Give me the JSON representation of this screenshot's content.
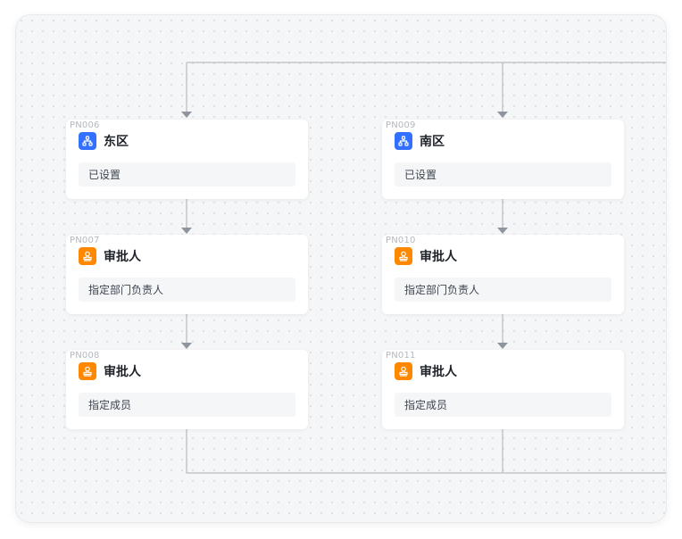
{
  "flow": {
    "columns": [
      {
        "nodes": [
          {
            "id": "PN006",
            "title": "东区",
            "icon": "branch-icon",
            "kind": "branch",
            "detail": "已设置"
          },
          {
            "id": "PN007",
            "title": "审批人",
            "icon": "stamp-icon",
            "kind": "approver",
            "detail": "指定部门负责人"
          },
          {
            "id": "PN008",
            "title": "审批人",
            "icon": "stamp-icon",
            "kind": "approver",
            "detail": "指定成员"
          }
        ]
      },
      {
        "nodes": [
          {
            "id": "PN009",
            "title": "南区",
            "icon": "branch-icon",
            "kind": "branch",
            "detail": "已设置"
          },
          {
            "id": "PN010",
            "title": "审批人",
            "icon": "stamp-icon",
            "kind": "approver",
            "detail": "指定部门负责人"
          },
          {
            "id": "PN011",
            "title": "审批人",
            "icon": "stamp-icon",
            "kind": "approver",
            "detail": "指定成员"
          }
        ]
      }
    ]
  },
  "colors": {
    "branch_icon_bg": "#3370ff",
    "approver_icon_bg": "#ff8800",
    "connector": "#c3c6cb"
  }
}
